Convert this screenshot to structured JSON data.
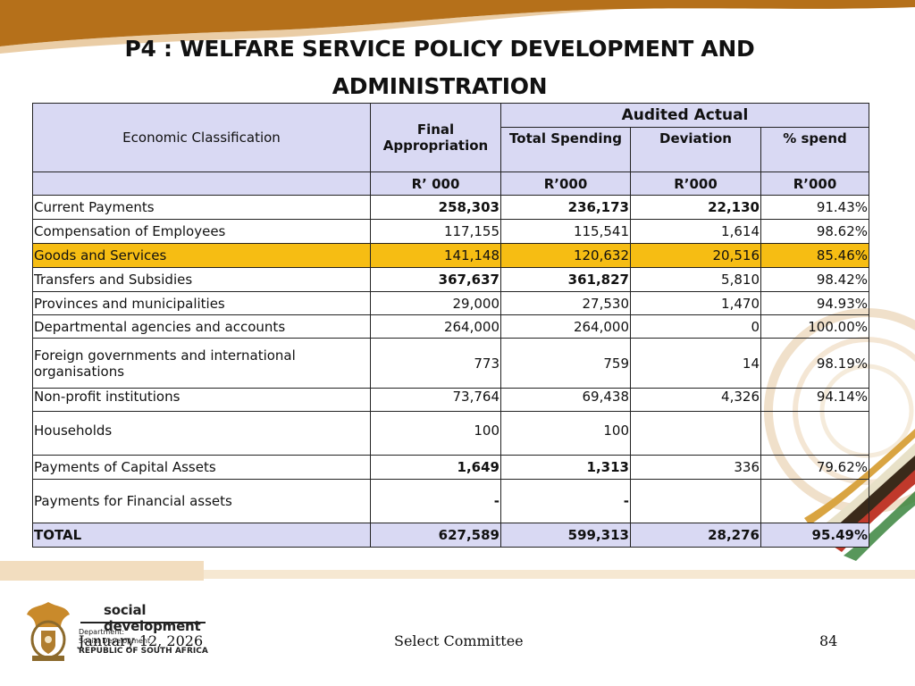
{
  "title_line1": "P4 : WELFARE SERVICE POLICY DEVELOPMENT AND",
  "title_line2": "ADMINISTRATION",
  "table": {
    "col_economic": "Economic Classification",
    "col_final_l1": "Final",
    "col_final_l2": "Appropriation",
    "col_audited": "Audited Actual",
    "col_total_spending": "Total Spending",
    "col_deviation": "Deviation",
    "col_pct_spend": "% spend",
    "unit_final": "R’ 000",
    "unit_total": "R’000",
    "unit_deviation": "R’000",
    "unit_pct": "R’000",
    "rows": [
      {
        "label": "Current Payments",
        "final": "258,303",
        "total": "236,173",
        "deviation": "22,130",
        "pct": "91.43%"
      },
      {
        "label": "Compensation of Employees",
        "final": "117,155",
        "total": "115,541",
        "deviation": "1,614",
        "pct": "98.62%"
      },
      {
        "label": "Goods and Services",
        "final": "141,148",
        "total": "120,632",
        "deviation": "20,516",
        "pct": "85.46%"
      },
      {
        "label": "Transfers and Subsidies",
        "final": "367,637",
        "total": "361,827",
        "deviation": "5,810",
        "pct": "98.42%"
      },
      {
        "label": "Provinces and municipalities",
        "final": "29,000",
        "total": "27,530",
        "deviation": "1,470",
        "pct": "94.93%"
      },
      {
        "label": "Departmental agencies and accounts",
        "final": "264,000",
        "total": "264,000",
        "deviation": "0",
        "pct": "100.00%"
      },
      {
        "label_l1": "Foreign governments and international",
        "label_l2": "organisations",
        "final": "773",
        "total": "759",
        "deviation": "14",
        "pct": "98.19%"
      },
      {
        "label": "Non-profit institutions",
        "final": "73,764",
        "total": "69,438",
        "deviation": "4,326",
        "pct": "94.14%"
      },
      {
        "label": "Households",
        "final": "100",
        "total": "100",
        "deviation": "",
        "pct": ""
      },
      {
        "label": "Payments of Capital Assets",
        "final": "1,649",
        "total": "1,313",
        "deviation": "336",
        "pct": "79.62%"
      },
      {
        "label": "Payments for Financial assets",
        "final": "-",
        "total": "-",
        "deviation": "",
        "pct": ""
      },
      {
        "label": "TOTAL",
        "final": "627,589",
        "total": "599,313",
        "deviation": "28,276",
        "pct": "95.49%"
      }
    ]
  },
  "logo": {
    "name": "social development",
    "dept_line1": "Department:",
    "dept_line2": "Social Development",
    "dept_line3": "REPUBLIC OF SOUTH AFRICA"
  },
  "footer": {
    "date": "January 12, 2026",
    "center": "Select Committee",
    "page": "84"
  },
  "colors": {
    "header_fill": "#d9d9f3",
    "highlight": "#f6bd13",
    "band": "#b5701a"
  }
}
